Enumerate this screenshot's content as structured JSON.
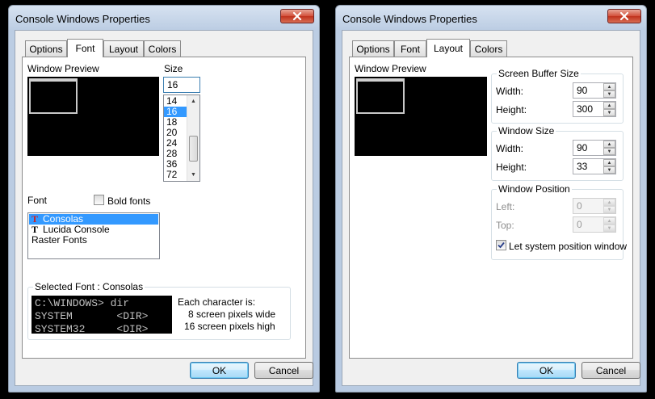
{
  "left_window": {
    "title": "Console Windows Properties",
    "tabs": [
      {
        "label": "Options"
      },
      {
        "label": "Font"
      },
      {
        "label": "Layout"
      },
      {
        "label": "Colors"
      }
    ],
    "active_tab": "Font",
    "window_preview_label": "Window Preview",
    "size": {
      "label": "Size",
      "value": "16",
      "options": [
        "14",
        "16",
        "18",
        "20",
        "24",
        "28",
        "36",
        "72"
      ],
      "selected": "16"
    },
    "font": {
      "label": "Font",
      "bold_fonts_label": "Bold fonts",
      "bold_checked": false,
      "items": [
        {
          "label": "Consolas",
          "icon": "truetype-font-icon",
          "selected": true
        },
        {
          "label": "Lucida Console",
          "icon": "truetype-font-icon",
          "selected": false
        },
        {
          "label": "Raster Fonts",
          "icon": "",
          "selected": false
        }
      ]
    },
    "selected_font": {
      "label": "Selected Font : Consolas",
      "preview_lines": [
        "C:\\WINDOWS> dir",
        "SYSTEM       <DIR>",
        "SYSTEM32     <DIR>"
      ],
      "char_info_title": "Each character is:",
      "width_text": "8 screen pixels wide",
      "height_text": "16 screen pixels high"
    },
    "ok_label": "OK",
    "cancel_label": "Cancel"
  },
  "right_window": {
    "title": "Console Windows Properties",
    "tabs": [
      {
        "label": "Options"
      },
      {
        "label": "Font"
      },
      {
        "label": "Layout"
      },
      {
        "label": "Colors"
      }
    ],
    "active_tab": "Layout",
    "window_preview_label": "Window Preview",
    "screen_buffer": {
      "label": "Screen Buffer Size",
      "width_label": "Width:",
      "width_value": "90",
      "height_label": "Height:",
      "height_value": "300"
    },
    "window_size": {
      "label": "Window Size",
      "width_label": "Width:",
      "width_value": "90",
      "height_label": "Height:",
      "height_value": "33"
    },
    "window_position": {
      "label": "Window Position",
      "left_label": "Left:",
      "left_value": "0",
      "top_label": "Top:",
      "top_value": "0",
      "let_system_label": "Let system position window",
      "let_system_checked": true
    },
    "ok_label": "OK",
    "cancel_label": "Cancel"
  },
  "icons": {
    "close": "close-icon",
    "font_type": "truetype-font-icon",
    "check": "checkmark-icon"
  }
}
